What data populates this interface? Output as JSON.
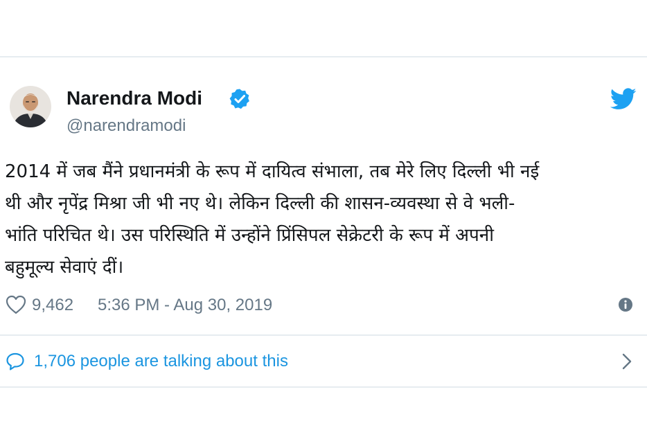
{
  "author": {
    "name": "Narendra Modi",
    "handle": "@narendramodi",
    "verified": true,
    "avatar_icon": "profile-photo"
  },
  "tweet": {
    "lines": [
      "2014 में जब मैंने प्रधानमंत्री के रूप में दायित्व संभाला, तब मेरे लिए दिल्ली भी नई",
      "थी और नृपेंद्र मिश्रा जी भी नए थे। लेकिन दिल्ली की शासन-व्यवस्था से वे भली-",
      "भांति परिचित थे। उस परिस्थिति में उन्होंने प्रिंसिपल सेक्रेटरी के रूप में अपनी",
      "बहुमूल्य सेवाएं दीं।"
    ]
  },
  "meta": {
    "likes": "9,462",
    "timestamp": "5:36 PM - Aug 30, 2019"
  },
  "conversation": {
    "label": "1,706 people are talking about this"
  },
  "icons": {
    "verified": "verified-badge-icon",
    "brand": "twitter-bird-icon",
    "like": "heart-icon",
    "info": "info-icon",
    "reply": "speech-bubble-icon",
    "more": "chevron-right-icon"
  },
  "colors": {
    "brand_blue": "#1da1f2",
    "link_blue": "#1b95e0",
    "muted_text": "#657786",
    "main_text": "#14171a",
    "divider": "#e6ecf0"
  }
}
